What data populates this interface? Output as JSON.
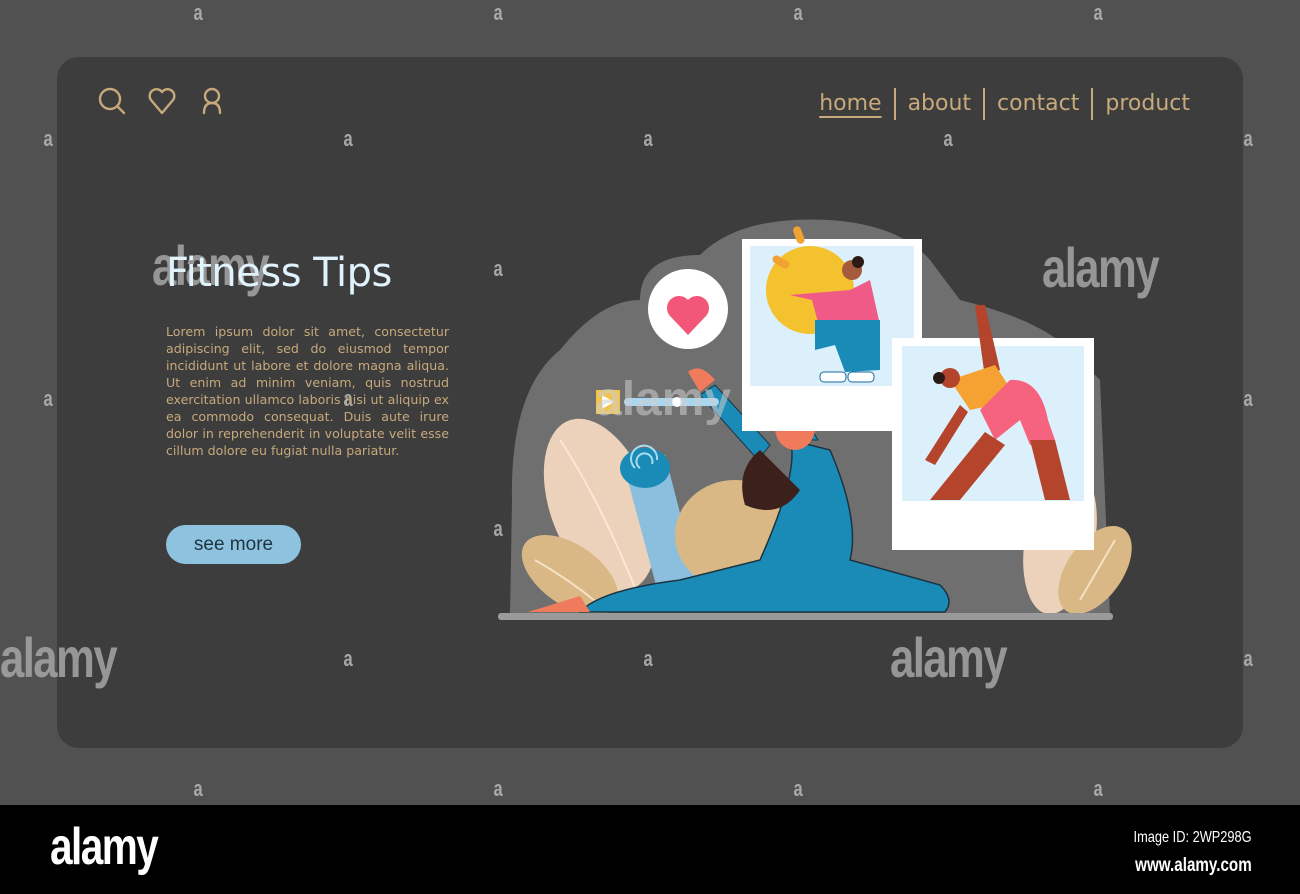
{
  "header": {
    "icons": [
      {
        "name": "search-icon",
        "label": "search"
      },
      {
        "name": "heart-icon",
        "label": "favorites"
      },
      {
        "name": "user-icon",
        "label": "account"
      }
    ],
    "nav": [
      {
        "label": "home",
        "active": true
      },
      {
        "label": "about",
        "active": false
      },
      {
        "label": "contact",
        "active": false
      },
      {
        "label": "product",
        "active": false
      }
    ]
  },
  "hero": {
    "title": "Fitness Tips",
    "body": "Lorem ipsum dolor sit amet, consectetur adipiscing elit, sed do eiusmod tempor incididunt ut labore et dolore magna aliqua. Ut enim ad minim veniam, quis nostrud exercitation ullamco laboris nisi ut aliquip ex ea commodo consequat. Duis aute irure dolor in reprehenderit in voluptate velit esse cillum dolore eu fugiat nulla pariatur.",
    "cta_label": "see more"
  },
  "illustration": {
    "subject": "woman stretching on floor with fitness photo cards",
    "cards": [
      "squat with exercise ball",
      "triangle yoga pose"
    ],
    "badges": [
      "heart-like-badge",
      "video-progress-bar"
    ]
  },
  "colors": {
    "page_bg": "#515151",
    "card_bg": "#3d3d3d",
    "accent_gold": "#c7a97b",
    "title_color": "#e0f2fb",
    "button_bg": "#8ec3e0",
    "heart_pink": "#f2577a"
  },
  "watermark": {
    "brand": "alamy",
    "letter": "a"
  },
  "footer": {
    "logo": "alamy",
    "image_id": "Image ID: 2WP298G",
    "url": "www.alamy.com"
  }
}
